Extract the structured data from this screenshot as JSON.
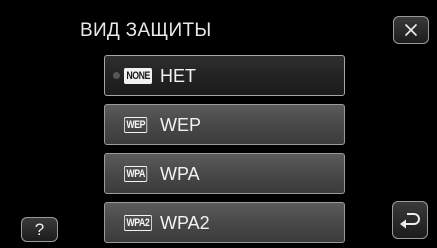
{
  "header": {
    "title": "ВИД ЗАЩИТЫ"
  },
  "buttons": {
    "close_icon": "close-x-icon",
    "help_label": "?",
    "back_icon": "return-arrow-icon"
  },
  "options": [
    {
      "badge": "NONE",
      "label": "НЕТ",
      "selected": true
    },
    {
      "badge": "WEP",
      "label": "WEP",
      "selected": false
    },
    {
      "badge": "WPA",
      "label": "WPA",
      "selected": false
    },
    {
      "badge": "WPA2",
      "label": "WPA2",
      "selected": false
    }
  ]
}
